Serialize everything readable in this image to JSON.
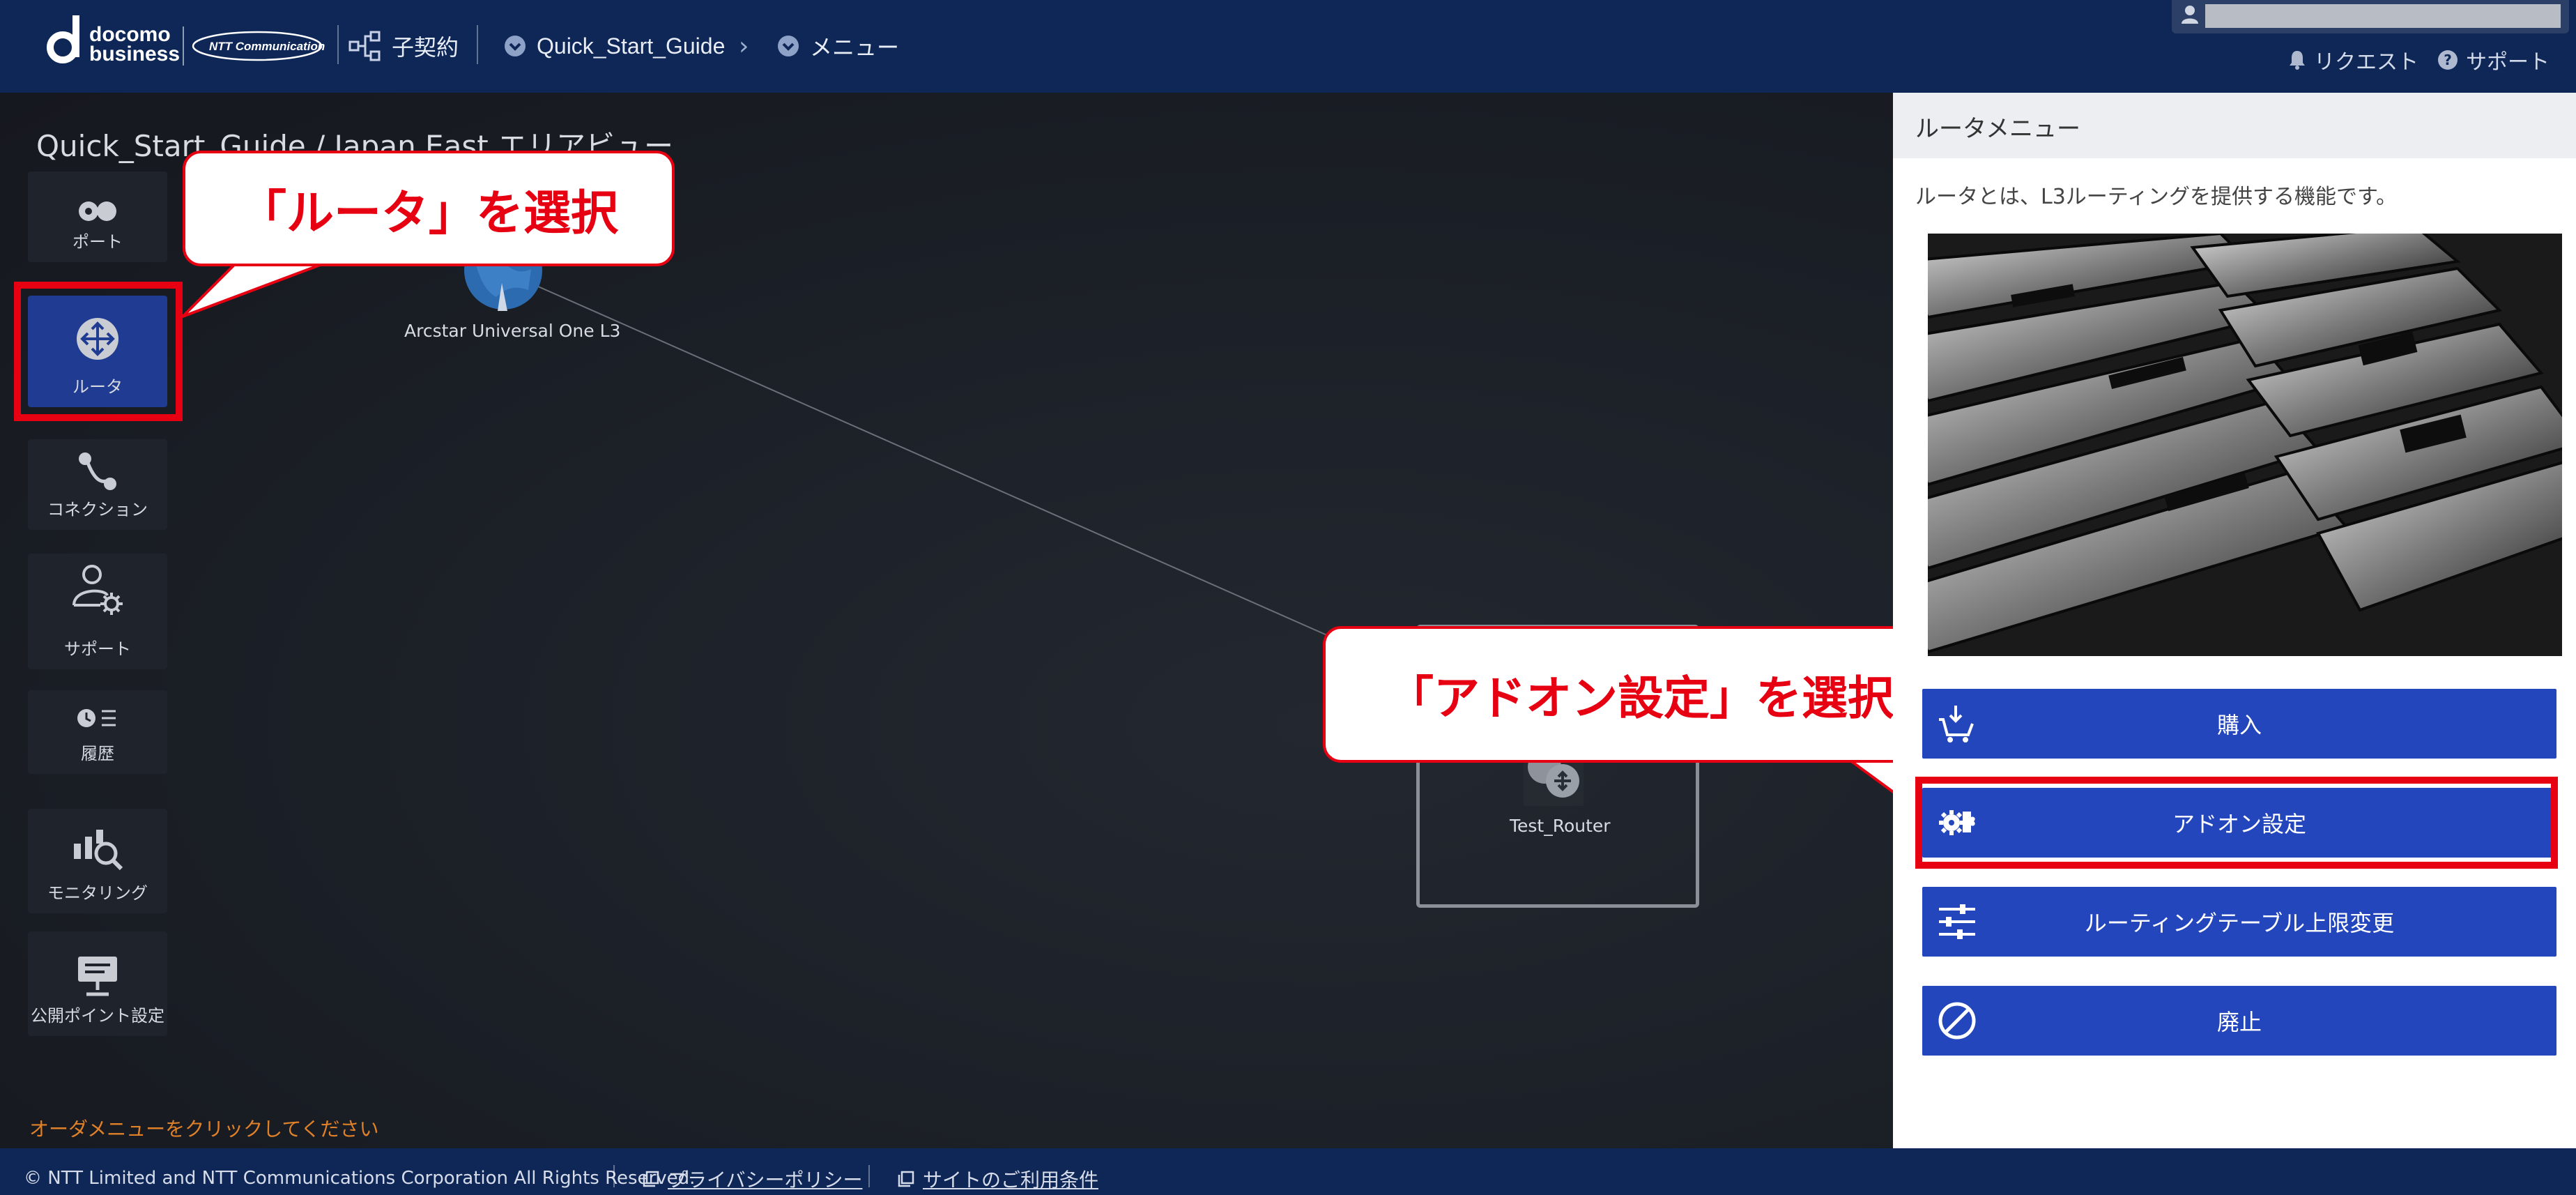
{
  "header": {
    "brand_line1": "docomo",
    "brand_line2": "business",
    "ntt_logo_text": "NTT Communications",
    "contract_label": "子契約",
    "breadcrumb": [
      "Quick_Start_Guide",
      "メニュー"
    ],
    "user_name": "",
    "request_label": "リクエスト",
    "support_label": "サポート"
  },
  "workspace": {
    "title": "Quick_Start_Guide / Japan East エリアビュー",
    "sidebar": [
      {
        "label": "ポート",
        "icon": "port-icon"
      },
      {
        "label": "ルータ",
        "icon": "router-icon"
      },
      {
        "label": "コネクション",
        "icon": "connection-icon"
      },
      {
        "label": "サポート",
        "icon": "support-user-icon"
      },
      {
        "label": "履歴",
        "icon": "history-icon"
      },
      {
        "label": "モニタリング",
        "icon": "monitoring-icon"
      },
      {
        "label": "公開ポイント設定",
        "icon": "public-point-icon"
      }
    ],
    "node_l3_label": "Arcstar Universal One L3",
    "node_router_label": "Test_Router",
    "order_message": "オーダメニューをクリックしてください"
  },
  "callouts": {
    "router": "「ルータ」を選択",
    "addon": "「アドオン設定」を選択"
  },
  "panel": {
    "title": "ルータメニュー",
    "description": "ルータとは、L3ルーティングを提供する機能です。",
    "buttons": [
      {
        "label": "購入",
        "icon": "cart-download-icon"
      },
      {
        "label": "アドオン設定",
        "icon": "puzzle-gear-icon"
      },
      {
        "label": "ルーティングテーブル上限変更",
        "icon": "sliders-icon"
      },
      {
        "label": "廃止",
        "icon": "prohibit-icon"
      }
    ]
  },
  "footer": {
    "copyright": "© NTT Limited and NTT Communications Corporation All Rights Reserved.",
    "privacy_label": "プライバシーポリシー",
    "terms_label": "サイトのご利用条件"
  },
  "colors": {
    "header_bg": "#0e2756",
    "accent_blue": "#2446bd",
    "highlight_red": "#e60012",
    "active_side": "#1f3b92",
    "order_text": "#e0812a"
  }
}
